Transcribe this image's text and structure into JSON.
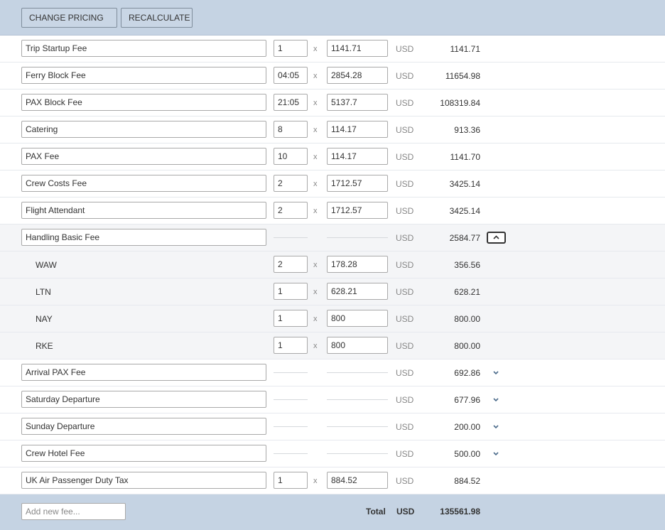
{
  "toolbar": {
    "change_pricing_label": "CHANGE PRICING",
    "recalculate_label": "RECALCULATE"
  },
  "fees": [
    {
      "name": "Trip Startup Fee",
      "qty": "1",
      "price": "1141.71",
      "currency": "USD",
      "amount": "1141.71",
      "type": "line"
    },
    {
      "name": "Ferry Block Fee",
      "qty": "04:05",
      "price": "2854.28",
      "currency": "USD",
      "amount": "11654.98",
      "type": "line"
    },
    {
      "name": "PAX Block Fee",
      "qty": "21:05",
      "price": "5137.7",
      "currency": "USD",
      "amount": "108319.84",
      "type": "line"
    },
    {
      "name": "Catering",
      "qty": "8",
      "price": "114.17",
      "currency": "USD",
      "amount": "913.36",
      "type": "line"
    },
    {
      "name": "PAX Fee",
      "qty": "10",
      "price": "114.17",
      "currency": "USD",
      "amount": "1141.70",
      "type": "line"
    },
    {
      "name": "Crew Costs Fee",
      "qty": "2",
      "price": "1712.57",
      "currency": "USD",
      "amount": "3425.14",
      "type": "line"
    },
    {
      "name": "Flight Attendant",
      "qty": "2",
      "price": "1712.57",
      "currency": "USD",
      "amount": "3425.14",
      "type": "line"
    },
    {
      "name": "Handling Basic Fee",
      "currency": "USD",
      "amount": "2584.77",
      "type": "group-expanded",
      "expand_icon": "chevron-up-icon"
    },
    {
      "name": "WAW",
      "qty": "2",
      "price": "178.28",
      "currency": "USD",
      "amount": "356.56",
      "type": "sub"
    },
    {
      "name": "LTN",
      "qty": "1",
      "price": "628.21",
      "currency": "USD",
      "amount": "628.21",
      "type": "sub"
    },
    {
      "name": "NAY",
      "qty": "1",
      "price": "800",
      "currency": "USD",
      "amount": "800.00",
      "type": "sub"
    },
    {
      "name": "RKE",
      "qty": "1",
      "price": "800",
      "currency": "USD",
      "amount": "800.00",
      "type": "sub"
    },
    {
      "name": "Arrival PAX Fee",
      "currency": "USD",
      "amount": "692.86",
      "type": "group-collapsed",
      "expand_icon": "chevron-down-icon"
    },
    {
      "name": "Saturday Departure",
      "currency": "USD",
      "amount": "677.96",
      "type": "group-collapsed",
      "expand_icon": "chevron-down-icon"
    },
    {
      "name": "Sunday Departure",
      "currency": "USD",
      "amount": "200.00",
      "type": "group-collapsed",
      "expand_icon": "chevron-down-icon"
    },
    {
      "name": "Crew Hotel Fee",
      "currency": "USD",
      "amount": "500.00",
      "type": "group-collapsed",
      "expand_icon": "chevron-down-icon"
    },
    {
      "name": "UK Air Passenger Duty Tax",
      "qty": "1",
      "price": "884.52",
      "currency": "USD",
      "amount": "884.52",
      "type": "line"
    }
  ],
  "multiply_symbol": "x",
  "footer": {
    "add_fee_placeholder": "Add new fee...",
    "total_label": "Total",
    "total_currency": "USD",
    "total_amount": "135561.98"
  },
  "colors": {
    "toolbar_bg": "#c5d3e3",
    "footer_bg": "#c5d3e3",
    "sub_row_bg": "#f4f5f7"
  }
}
